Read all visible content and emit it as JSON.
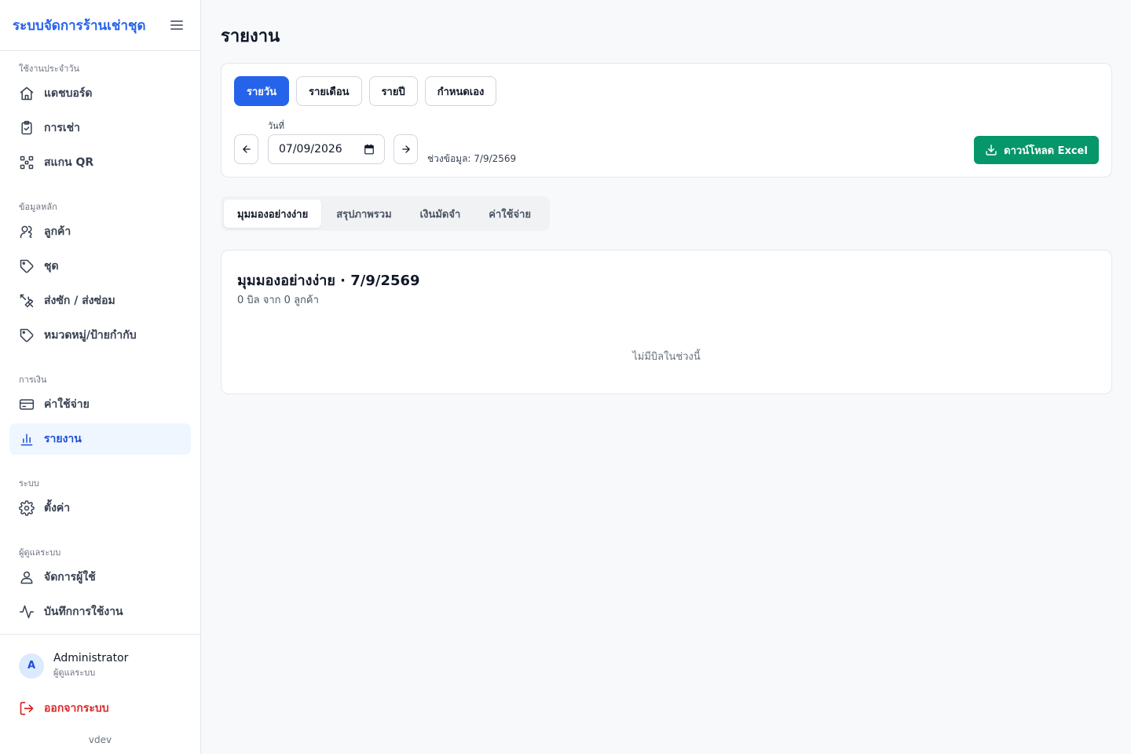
{
  "app": {
    "title": "ระบบจัดการร้านเช่าชุด"
  },
  "sidebar": {
    "sections": [
      {
        "label": "ใช้งานประจำวัน",
        "items": [
          {
            "label": "แดชบอร์ด",
            "icon": "home-icon"
          },
          {
            "label": "การเช่า",
            "icon": "clipboard-check-icon"
          },
          {
            "label": "สแกน QR",
            "icon": "qr-scan-icon"
          }
        ]
      },
      {
        "label": "ข้อมูลหลัก",
        "items": [
          {
            "label": "ลูกค้า",
            "icon": "users-icon"
          },
          {
            "label": "ชุด",
            "icon": "tag-icon"
          },
          {
            "label": "ส่งซัก / ส่งซ่อม",
            "icon": "tools-icon"
          },
          {
            "label": "หมวดหมู่/ป้ายกำกับ",
            "icon": "tag-icon"
          }
        ]
      },
      {
        "label": "การเงิน",
        "items": [
          {
            "label": "ค่าใช้จ่าย",
            "icon": "credit-card-icon"
          },
          {
            "label": "รายงาน",
            "icon": "bar-chart-icon",
            "active": true
          }
        ]
      },
      {
        "label": "ระบบ",
        "items": [
          {
            "label": "ตั้งค่า",
            "icon": "gear-icon"
          }
        ]
      },
      {
        "label": "ผู้ดูแลระบบ",
        "items": [
          {
            "label": "จัดการผู้ใช้",
            "icon": "user-icon"
          },
          {
            "label": "บันทึกการใช้งาน",
            "icon": "activity-icon"
          }
        ]
      }
    ],
    "user": {
      "initial": "A",
      "name": "Administrator",
      "role": "ผู้ดูแลระบบ"
    },
    "logout_label": "ออกจากระบบ",
    "version": "vdev"
  },
  "page": {
    "title": "รายงาน"
  },
  "filters": {
    "periods": [
      "รายวัน",
      "รายเดือน",
      "รายปี",
      "กำหนดเอง"
    ],
    "active_period": "รายวัน",
    "date_label": "วันที่",
    "date_value": "07/09/2026",
    "range_text": "ช่วงข้อมูล: 7/9/2569",
    "download_label": "ดาวน์โหลด Excel"
  },
  "tabs": {
    "items": [
      "มุมมองอย่างง่าย",
      "สรุปภาพรวม",
      "เงินมัดจำ",
      "ค่าใช้จ่าย"
    ],
    "active": "มุมมองอย่างง่าย"
  },
  "result": {
    "title": "มุมมองอย่างง่าย · 7/9/2569",
    "subtitle": "0 บิล จาก 0 ลูกค้า",
    "empty_message": "ไม่มีบิลในช่วงนี้"
  },
  "colors": {
    "primary": "#2563eb",
    "success": "#059669",
    "danger": "#dc2626"
  }
}
